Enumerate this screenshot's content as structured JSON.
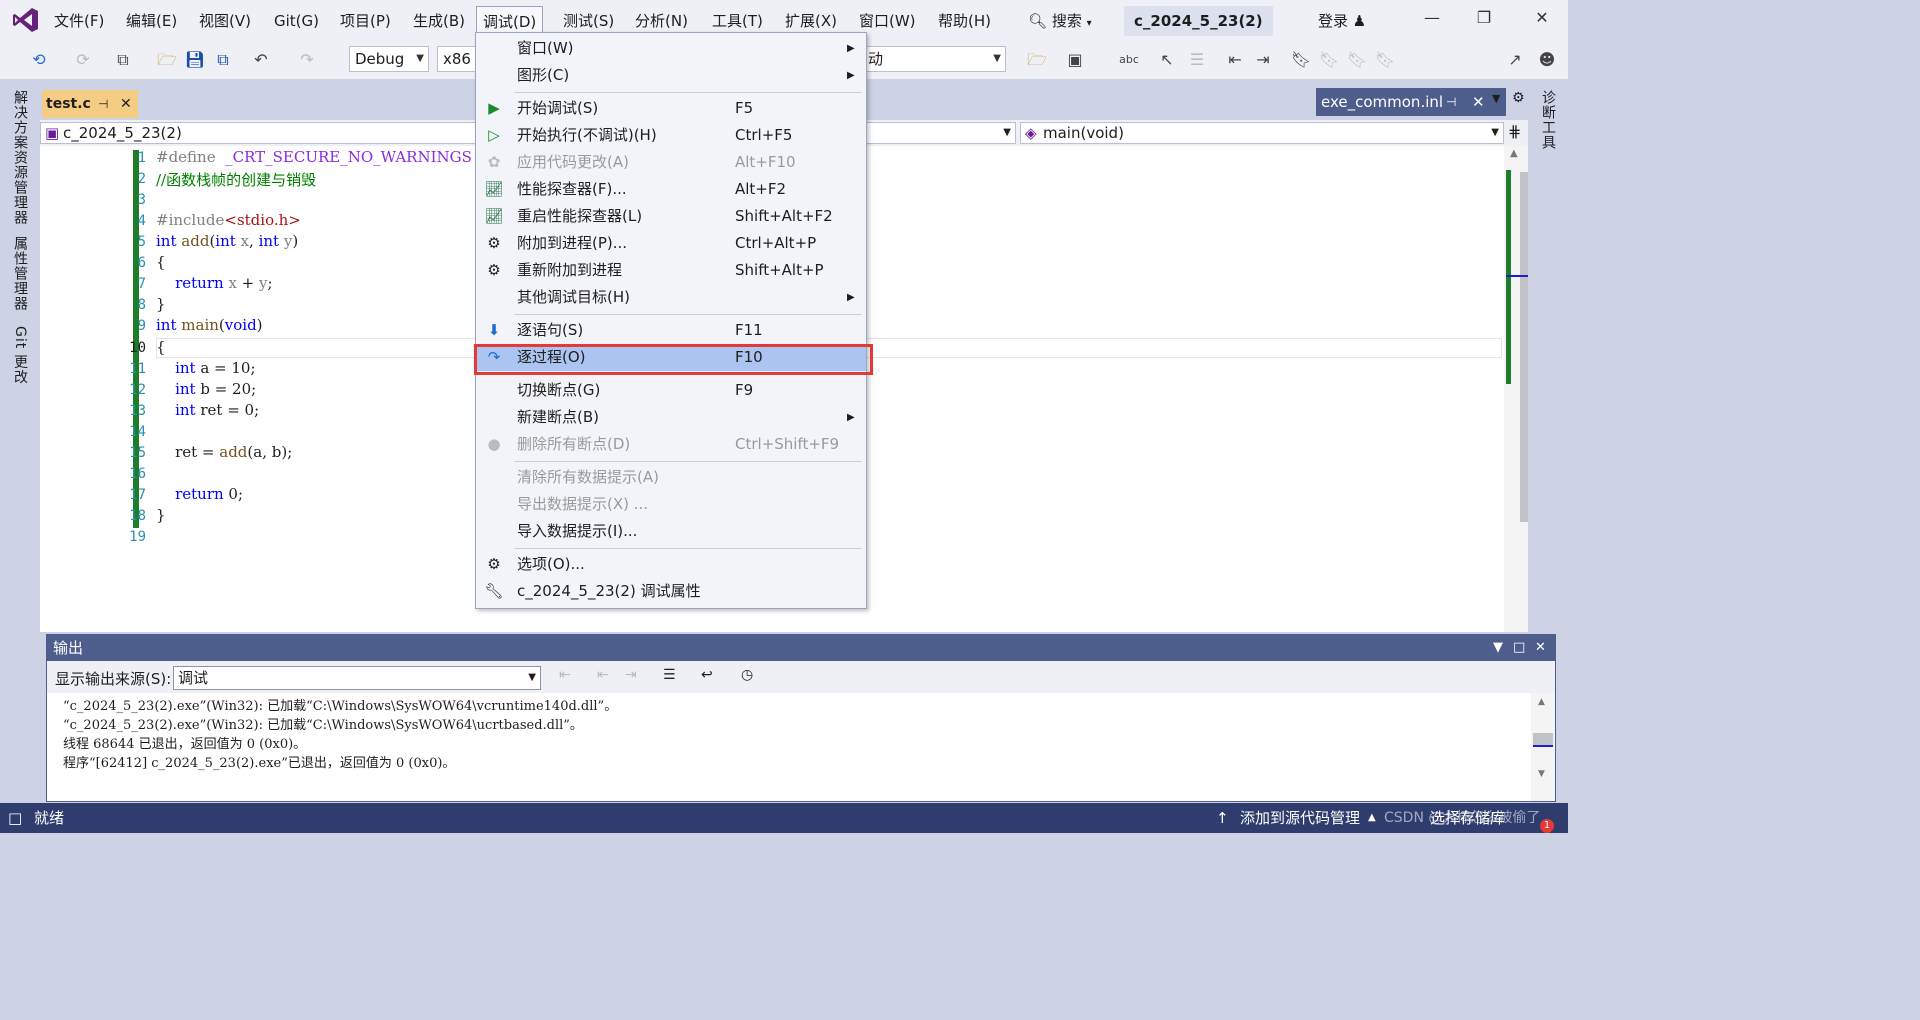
{
  "menubar": {
    "items": [
      "文件(F)",
      "编辑(E)",
      "视图(V)",
      "Git(G)",
      "项目(P)",
      "生成(B)",
      "调试(D)",
      "测试(S)",
      "分析(N)",
      "工具(T)",
      "扩展(X)",
      "窗口(W)",
      "帮助(H)"
    ],
    "search_label": "搜索",
    "solution_name": "c_2024_5_23(2)",
    "login_label": "登录"
  },
  "toolbar": {
    "config": "Debug",
    "platform": "x86",
    "startup_partial": "动"
  },
  "left_rail": [
    "解决方案资源管理器",
    "属性管理器",
    "Git 更改"
  ],
  "right_rail": [
    "诊断工具"
  ],
  "doc_tabs": {
    "active": "test.c",
    "secondary": "exe_common.inl"
  },
  "navbar": {
    "project": "c_2024_5_23(2)",
    "member": "main(void)"
  },
  "editor": {
    "current_line": 10,
    "line_numbers": [
      "1",
      "2",
      "3",
      "4",
      "5",
      "6",
      "7",
      "8",
      "9",
      "10",
      "11",
      "12",
      "13",
      "14",
      "15",
      "16",
      "17",
      "18",
      "19"
    ]
  },
  "debug_menu": {
    "items": [
      {
        "label": "窗口(W)",
        "shortcut": "",
        "submenu": true,
        "disabled": false
      },
      {
        "label": "图形(C)",
        "shortcut": "",
        "submenu": true,
        "disabled": false
      },
      {
        "label": "开始调试(S)",
        "shortcut": "F5",
        "submenu": false,
        "disabled": false
      },
      {
        "label": "开始执行(不调试)(H)",
        "shortcut": "Ctrl+F5",
        "submenu": false,
        "disabled": false
      },
      {
        "label": "应用代码更改(A)",
        "shortcut": "Alt+F10",
        "submenu": false,
        "disabled": true
      },
      {
        "label": "性能探查器(F)...",
        "shortcut": "Alt+F2",
        "submenu": false,
        "disabled": false
      },
      {
        "label": "重启性能探查器(L)",
        "shortcut": "Shift+Alt+F2",
        "submenu": false,
        "disabled": false
      },
      {
        "label": "附加到进程(P)...",
        "shortcut": "Ctrl+Alt+P",
        "submenu": false,
        "disabled": false
      },
      {
        "label": "重新附加到进程",
        "shortcut": "Shift+Alt+P",
        "submenu": false,
        "disabled": false
      },
      {
        "label": "其他调试目标(H)",
        "shortcut": "",
        "submenu": true,
        "disabled": false
      },
      {
        "label": "逐语句(S)",
        "shortcut": "F11",
        "submenu": false,
        "disabled": false
      },
      {
        "label": "逐过程(O)",
        "shortcut": "F10",
        "submenu": false,
        "disabled": false,
        "highlighted": true
      },
      {
        "label": "切换断点(G)",
        "shortcut": "F9",
        "submenu": false,
        "disabled": false
      },
      {
        "label": "新建断点(B)",
        "shortcut": "",
        "submenu": true,
        "disabled": false
      },
      {
        "label": "删除所有断点(D)",
        "shortcut": "Ctrl+Shift+F9",
        "submenu": false,
        "disabled": true
      },
      {
        "label": "清除所有数据提示(A)",
        "shortcut": "",
        "submenu": false,
        "disabled": true
      },
      {
        "label": "导出数据提示(X) ...",
        "shortcut": "",
        "submenu": false,
        "disabled": true
      },
      {
        "label": "导入数据提示(I)...",
        "shortcut": "",
        "submenu": false,
        "disabled": false
      },
      {
        "label": "选项(O)...",
        "shortcut": "",
        "submenu": false,
        "disabled": false
      },
      {
        "label": "c_2024_5_23(2) 调试属性",
        "shortcut": "",
        "submenu": false,
        "disabled": false
      }
    ]
  },
  "output": {
    "title": "输出",
    "source_label": "显示输出来源(S):",
    "source_value": "调试",
    "lines": [
      "“c_2024_5_23(2).exe”(Win32): 已加载“C:\\Windows\\SysWOW64\\vcruntime140d.dll”。",
      "“c_2024_5_23(2).exe”(Win32): 已加载“C:\\Windows\\SysWOW64\\ucrtbased.dll”。",
      "线程 68644 已退出，返回值为 0 (0x0)。",
      "程序“[62412] c_2024_5_23(2).exe”已退出，返回值为 0 (0x0)。"
    ]
  },
  "statusbar": {
    "ready": "就绪",
    "source_control": "添加到源代码管理",
    "select_repo": "选择存储库",
    "watermark": "CSDN @大棒怎么被偷了",
    "notification_count": "1"
  },
  "colors": {
    "accent": "#4d5e8c",
    "highlight": "#abc4f0",
    "red_box": "#e53935",
    "green_change": "#1e7d2a",
    "statusbar": "#2e3d6e"
  }
}
